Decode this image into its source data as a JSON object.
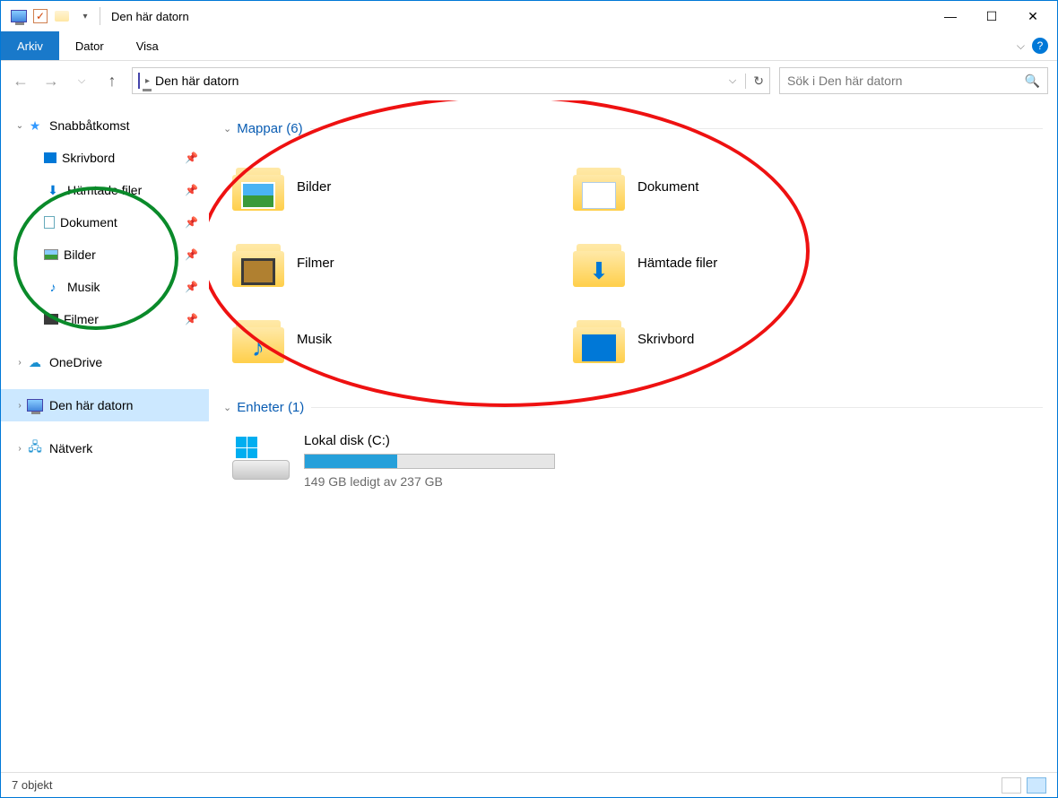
{
  "window": {
    "title": "Den här datorn"
  },
  "ribbon": {
    "tabs": {
      "file": "Arkiv",
      "computer": "Dator",
      "view": "Visa"
    }
  },
  "address": {
    "crumb": "Den här datorn"
  },
  "search": {
    "placeholder": "Sök i Den här datorn"
  },
  "sidebar": {
    "quick_access": "Snabbåtkomst",
    "items": [
      {
        "label": "Skrivbord",
        "pinned": true
      },
      {
        "label": "Hämtade filer",
        "pinned": true
      },
      {
        "label": "Dokument",
        "pinned": true
      },
      {
        "label": "Bilder",
        "pinned": true
      },
      {
        "label": "Musik",
        "pinned": true
      },
      {
        "label": "Filmer",
        "pinned": true
      }
    ],
    "onedrive": "OneDrive",
    "this_pc": "Den här datorn",
    "network": "Nätverk"
  },
  "sections": {
    "folders": {
      "name": "Mappar",
      "count": "(6)"
    },
    "devices": {
      "name": "Enheter",
      "count": "(1)"
    }
  },
  "folders": {
    "bilder": "Bilder",
    "dokument": "Dokument",
    "filmer": "Filmer",
    "hamtade": "Hämtade filer",
    "musik": "Musik",
    "skrivbord": "Skrivbord"
  },
  "drive": {
    "name": "Lokal disk (C:)",
    "free_text": "149 GB ledigt av 237 GB",
    "used_pct": 37
  },
  "status": {
    "count": "7 objekt"
  }
}
